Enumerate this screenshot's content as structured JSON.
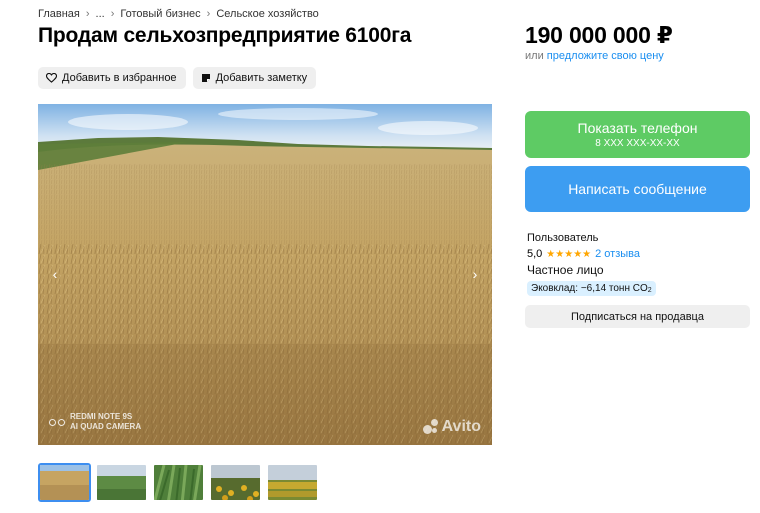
{
  "breadcrumb": {
    "items": [
      "Главная",
      "...",
      "Готовый бизнес",
      "Сельское хозяйство"
    ],
    "separator": "›"
  },
  "listing": {
    "title": "Продам сельхозпредприятие 6100га",
    "add_favorite": "Добавить в избранное",
    "add_note": "Добавить заметку"
  },
  "gallery": {
    "prev_label": "‹",
    "next_label": "›",
    "watermark_device_line1": "REDMI NOTE 9S",
    "watermark_device_line2": "AI QUAD CAMERA",
    "watermark_brand": "Avito",
    "thumbnails": [
      "wheat-field",
      "green-field",
      "green-crop",
      "sunflower-field",
      "sunflower-field-wide"
    ],
    "active_thumbnail": 0
  },
  "price": {
    "amount": "190 000 000 ₽",
    "or_text": "или",
    "offer_link": "предложите свою цену"
  },
  "contact": {
    "show_phone": "Показать телефон",
    "phone_mask": "8 XXX XXX-XX-XX",
    "write_message": "Написать сообщение"
  },
  "seller": {
    "name": "Пользователь",
    "rating": "5,0",
    "stars": "★★★★★",
    "reviews": "2 отзыва",
    "type": "Частное лицо",
    "eco_prefix": "Эковклад: −6,14 тонн CO",
    "eco_subscript": "2",
    "subscribe": "Подписаться на продавца"
  },
  "colors": {
    "phone_button": "#5ecb64",
    "message_button": "#3d9df1",
    "link": "#1a8ef0",
    "star": "#ffa600",
    "eco_badge": "#daf0ff",
    "chip_bg": "#efefef"
  }
}
